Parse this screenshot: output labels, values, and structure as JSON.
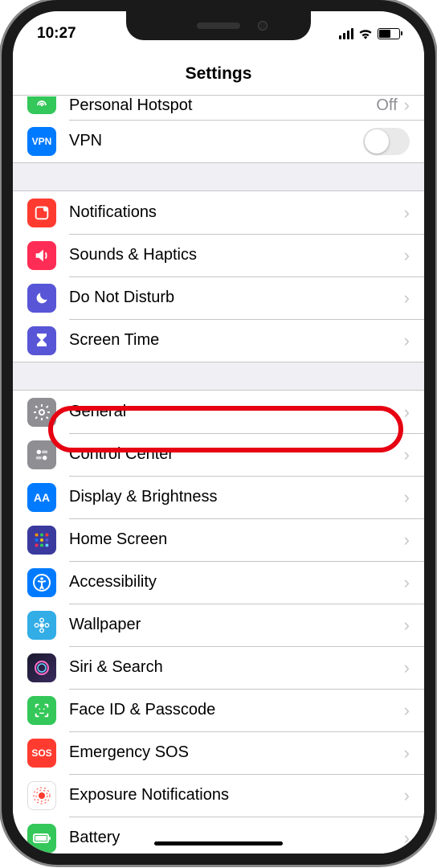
{
  "status": {
    "time": "10:27"
  },
  "header": {
    "title": "Settings"
  },
  "section1": {
    "hotspot": {
      "label": "Personal Hotspot",
      "value": "Off"
    },
    "vpn": {
      "label": "VPN",
      "icon": "VPN"
    }
  },
  "section2": {
    "notifications": {
      "label": "Notifications"
    },
    "sounds": {
      "label": "Sounds & Haptics"
    },
    "dnd": {
      "label": "Do Not Disturb"
    },
    "screentime": {
      "label": "Screen Time"
    }
  },
  "section3": {
    "general": {
      "label": "General"
    },
    "control": {
      "label": "Control Center"
    },
    "display": {
      "label": "Display & Brightness",
      "icon": "AA"
    },
    "home": {
      "label": "Home Screen"
    },
    "accessibility": {
      "label": "Accessibility"
    },
    "wallpaper": {
      "label": "Wallpaper"
    },
    "siri": {
      "label": "Siri & Search"
    },
    "faceid": {
      "label": "Face ID & Passcode"
    },
    "sos": {
      "label": "Emergency SOS",
      "icon": "SOS"
    },
    "exposure": {
      "label": "Exposure Notifications"
    },
    "battery": {
      "label": "Battery"
    }
  },
  "annotation": {
    "highlighted_row": "general"
  }
}
